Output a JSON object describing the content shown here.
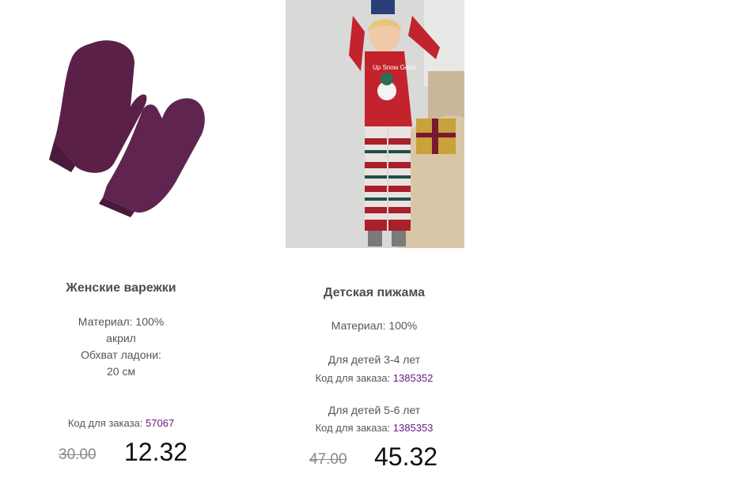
{
  "products": [
    {
      "title": "Женские варежки",
      "desc_lines": [
        "Материал: 100%",
        "акрил",
        "Обхват ладони:",
        "20 см"
      ],
      "code_label": "Код для заказа:",
      "code": "57067",
      "old_price": "30.00",
      "new_price": "12.32",
      "image_icon": "mittens-image",
      "image_color": "#5a2048"
    },
    {
      "title": "Детская пижама",
      "material": "Материал: 100%",
      "variants": [
        {
          "label": "Для детей 3-4 лет",
          "code_label": "Код для заказа:",
          "code": "1385352"
        },
        {
          "label": "Для детей  5-6 лет",
          "code_label": "Код для заказа:",
          "code": "1385353"
        }
      ],
      "old_price": "47.00",
      "new_price": "45.32",
      "image_icon": "pajama-photo",
      "image_print": "Up Snow Good"
    }
  ],
  "colors": {
    "code": "#6a1b8a",
    "title": "#4a4f53"
  }
}
